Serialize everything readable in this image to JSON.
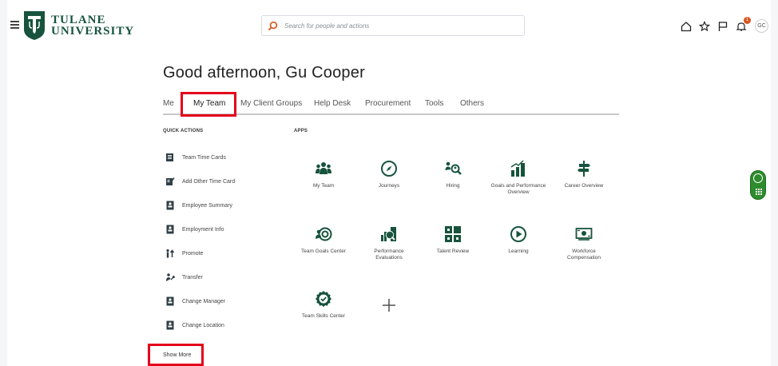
{
  "header": {
    "logo_line1": "TULANE",
    "logo_line2": "UNIVERSITY",
    "search_placeholder": "Search for people and actions",
    "icons": [
      "home-icon",
      "star-icon",
      "flag-icon",
      "bell-icon"
    ],
    "notification_count": "1",
    "avatar_initials": "GC"
  },
  "greeting": "Good afternoon, Gu Cooper",
  "tabs": [
    {
      "label": "Me"
    },
    {
      "label": "My Team"
    },
    {
      "label": "My Client Groups"
    },
    {
      "label": "Help Desk"
    },
    {
      "label": "Procurement"
    },
    {
      "label": "Tools"
    },
    {
      "label": "Others"
    }
  ],
  "active_tab": "My Team",
  "quick_actions": {
    "title": "QUICK ACTIONS",
    "items": [
      {
        "label": "Team Time Cards",
        "icon": "time-cards-icon"
      },
      {
        "label": "Add Other Time Card",
        "icon": "add-time-card-icon"
      },
      {
        "label": "Employee Summary",
        "icon": "employee-summary-icon"
      },
      {
        "label": "Employment Info",
        "icon": "employment-info-icon"
      },
      {
        "label": "Promote",
        "icon": "promote-icon"
      },
      {
        "label": "Transfer",
        "icon": "transfer-icon"
      },
      {
        "label": "Change Manager",
        "icon": "change-manager-icon"
      },
      {
        "label": "Change Location",
        "icon": "change-location-icon"
      }
    ],
    "show_more": "Show More"
  },
  "apps": {
    "title": "APPS",
    "items": [
      {
        "label": "My Team",
        "icon": "team-icon"
      },
      {
        "label": "Journeys",
        "icon": "compass-icon"
      },
      {
        "label": "Hiring",
        "icon": "hiring-icon"
      },
      {
        "label": "Goals and Performance Overview",
        "icon": "bar-chart-icon"
      },
      {
        "label": "Career Overview",
        "icon": "signpost-icon"
      },
      {
        "label": "Team Goals Center",
        "icon": "target-icon"
      },
      {
        "label": "Performance Evaluations",
        "icon": "performance-icon"
      },
      {
        "label": "Talent Review",
        "icon": "grid-people-icon"
      },
      {
        "label": "Learning",
        "icon": "play-icon"
      },
      {
        "label": "Workforce Compensation",
        "icon": "compensation-icon"
      },
      {
        "label": "Team Skills Center",
        "icon": "skills-badge-icon"
      }
    ]
  },
  "colors": {
    "brand_green": "#17533d",
    "highlight_red": "#e4001b",
    "search_orange": "#d9541e",
    "widget_green": "#2e8b2e"
  }
}
